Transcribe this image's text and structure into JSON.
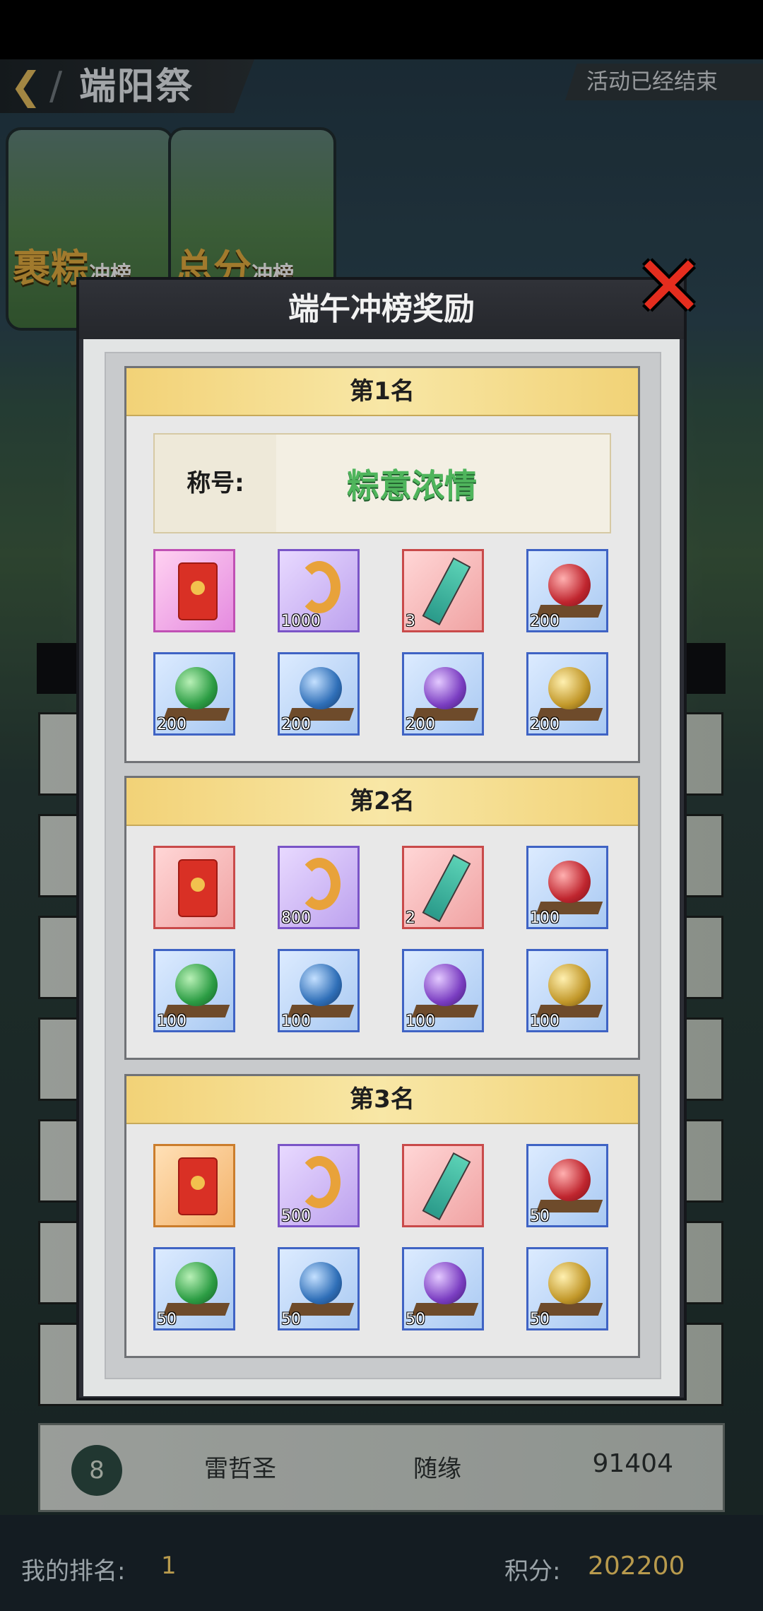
{
  "header": {
    "back_symbol": "❮",
    "title": "端阳祭",
    "status": "活动已经结束"
  },
  "tabs": [
    {
      "label": "裹粽",
      "sub": "冲榜"
    },
    {
      "label": "总分",
      "sub": "冲榜"
    }
  ],
  "modal": {
    "title": "端午冲榜奖励",
    "close_symbol": "✕",
    "sections": [
      {
        "heading": "第1名",
        "title_label": "称号:",
        "title_value": "粽意浓情",
        "items": [
          {
            "icon": "red-envelope",
            "qty": ""
          },
          {
            "icon": "golden-fish",
            "qty": "1000"
          },
          {
            "icon": "jade-scroll",
            "qty": "3"
          },
          {
            "icon": "red-orb",
            "qty": "200"
          },
          {
            "icon": "green-orb",
            "qty": "200"
          },
          {
            "icon": "blue-orb",
            "qty": "200"
          },
          {
            "icon": "purple-orb",
            "qty": "200"
          },
          {
            "icon": "gold-orb",
            "qty": "200"
          }
        ]
      },
      {
        "heading": "第2名",
        "items": [
          {
            "icon": "red-envelope",
            "qty": ""
          },
          {
            "icon": "golden-fish",
            "qty": "800"
          },
          {
            "icon": "jade-scroll",
            "qty": "2"
          },
          {
            "icon": "red-orb",
            "qty": "100"
          },
          {
            "icon": "green-orb",
            "qty": "100"
          },
          {
            "icon": "blue-orb",
            "qty": "100"
          },
          {
            "icon": "purple-orb",
            "qty": "100"
          },
          {
            "icon": "gold-orb",
            "qty": "100"
          }
        ]
      },
      {
        "heading": "第3名",
        "items": [
          {
            "icon": "red-envelope",
            "qty": ""
          },
          {
            "icon": "golden-fish",
            "qty": "500"
          },
          {
            "icon": "jade-scroll",
            "qty": ""
          },
          {
            "icon": "red-orb",
            "qty": "50"
          },
          {
            "icon": "green-orb",
            "qty": "50"
          },
          {
            "icon": "blue-orb",
            "qty": "50"
          },
          {
            "icon": "purple-orb",
            "qty": "50"
          },
          {
            "icon": "gold-orb",
            "qty": "50"
          }
        ]
      }
    ]
  },
  "leaderboard": {
    "visible_row": {
      "rank": "8",
      "name": "雷哲圣",
      "guild": "随缘",
      "score": "91404"
    }
  },
  "footer": {
    "my_rank_label": "我的排名:",
    "my_rank_value": "1",
    "score_label": "积分:",
    "score_value": "202200"
  },
  "colors": {
    "accent_gold": "#d8b35a",
    "close_red": "#e52d1e",
    "section_head_gold": "#f2d277"
  }
}
